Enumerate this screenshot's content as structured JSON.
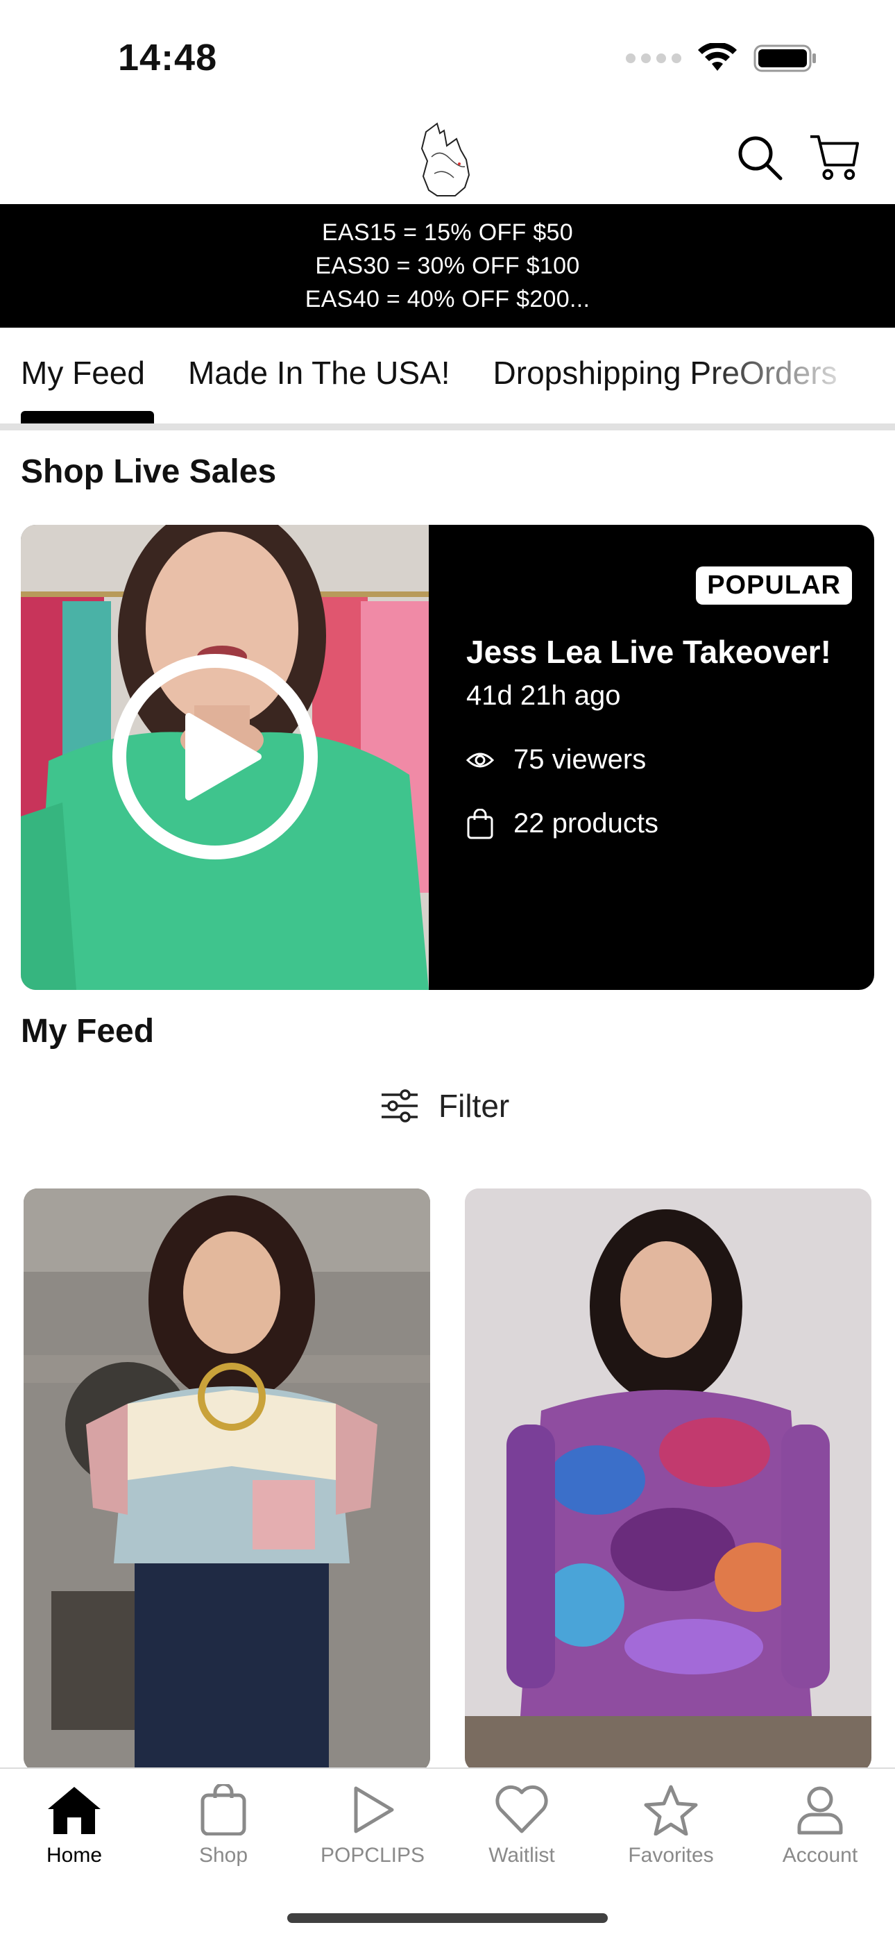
{
  "status_bar": {
    "time": "14:48"
  },
  "promo": {
    "lines": [
      "EAS15 = 15% OFF $50",
      "EAS30 = 30% OFF $100",
      "EAS40 = 40% OFF $200..."
    ]
  },
  "tabs": [
    {
      "label": "My Feed",
      "active": true
    },
    {
      "label": "Made In The USA!",
      "active": false
    },
    {
      "label": "Dropshipping PreOrders",
      "active": false
    }
  ],
  "live_section": {
    "title": "Shop Live Sales",
    "card": {
      "badge": "POPULAR",
      "title": "Jess Lea Live Takeover!",
      "time": "41d 21h ago",
      "viewers": "75 viewers",
      "products": "22 products"
    }
  },
  "feed_section": {
    "title": "My Feed",
    "filter_label": "Filter"
  },
  "bottom_nav": [
    {
      "label": "Home",
      "icon": "home-icon",
      "active": true
    },
    {
      "label": "Shop",
      "icon": "shopping-bag-icon",
      "active": false
    },
    {
      "label": "POPCLIPS",
      "icon": "play-icon",
      "active": false
    },
    {
      "label": "Waitlist",
      "icon": "heart-icon",
      "active": false
    },
    {
      "label": "Favorites",
      "icon": "star-icon",
      "active": false
    },
    {
      "label": "Account",
      "icon": "person-icon",
      "active": false
    }
  ],
  "colors": {
    "accent": "#000000",
    "inactive": "#8a8a8a",
    "banner_bg": "#000000"
  }
}
